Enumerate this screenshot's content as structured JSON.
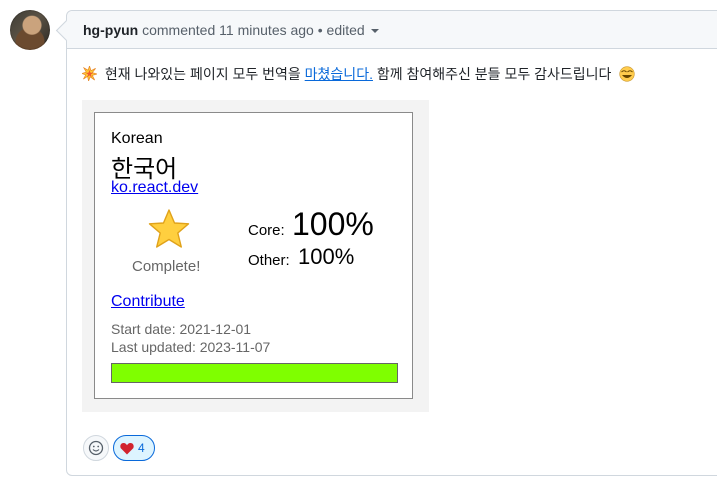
{
  "comment": {
    "author": "hg-pyun",
    "action": "commented",
    "time": "11 minutes ago",
    "separator": "•",
    "edited": "edited",
    "body_prefix": " 현재 나와있는 페이지 모두 번역을 ",
    "body_link": "마쳤습니다.",
    "body_suffix": " 함께 참여해주신 분들 모두 감사드립니다 "
  },
  "card": {
    "language_en": "Korean",
    "language_native": "한국어",
    "url": "ko.react.dev",
    "complete_label": "Complete!",
    "core_label": "Core:",
    "core_value": "100%",
    "other_label": "Other:",
    "other_value": "100%",
    "contribute_label": "Contribute",
    "start_date": "Start date: 2021-12-01",
    "last_updated": "Last updated: 2023-11-07",
    "progress_percent": 100
  },
  "reactions": {
    "heart_count": "4"
  },
  "colors": {
    "link": "#0969da",
    "progress_fill": "#7fff00",
    "card_link": "#0000ee"
  },
  "icons": [
    "collision-icon",
    "face-emoji-icon",
    "star-icon",
    "smiley-add-icon",
    "heart-icon",
    "chevron-down-icon"
  ]
}
